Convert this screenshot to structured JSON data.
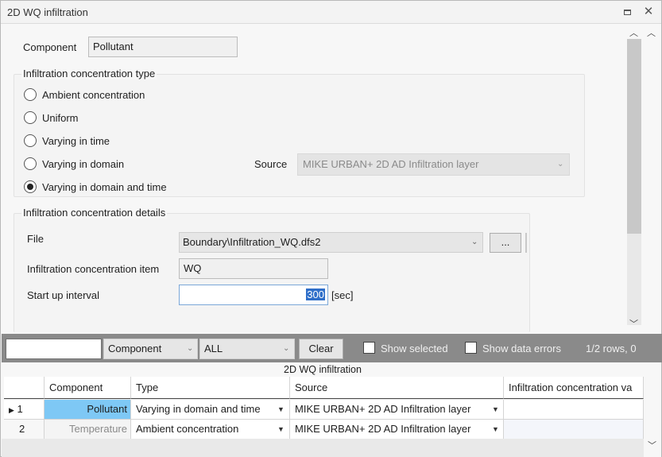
{
  "window": {
    "title": "2D WQ infiltration"
  },
  "form": {
    "component_label": "Component",
    "component_value": "Pollutant",
    "type_group_title": "Infiltration concentration type",
    "radio_options": [
      {
        "label": "Ambient concentration",
        "checked": false
      },
      {
        "label": "Uniform",
        "checked": false
      },
      {
        "label": "Varying in time",
        "checked": false
      },
      {
        "label": "Varying in domain",
        "checked": false
      },
      {
        "label": "Varying in domain and time",
        "checked": true
      }
    ],
    "source_label": "Source",
    "source_value": "MIKE URBAN+ 2D AD Infiltration layer",
    "details_group_title": "Infiltration concentration details",
    "file_label": "File",
    "file_value": "Boundary\\Infiltration_WQ.dfs2",
    "browse_button": "...",
    "item_label": "Infiltration concentration item",
    "item_value": "WQ",
    "startup_label": "Start up  interval",
    "startup_value": "300",
    "startup_unit": "[sec]"
  },
  "toolbar": {
    "search_value": "",
    "field_combo": "Component",
    "filter_combo": "ALL",
    "clear_button": "Clear",
    "show_selected": "Show selected",
    "show_errors": "Show data errors",
    "rows_info": "1/2 rows, 0"
  },
  "grid": {
    "caption": "2D WQ infiltration",
    "columns": [
      "Component",
      "Type",
      "Source",
      "Infiltration concentration va"
    ],
    "rows": [
      {
        "index": "1",
        "component": "Pollutant",
        "type": "Varying in domain and time",
        "source": "MIKE URBAN+ 2D AD Infiltration layer",
        "value": "",
        "current": true
      },
      {
        "index": "2",
        "component": "Temperature",
        "type": "Ambient concentration",
        "source": "MIKE URBAN+ 2D AD Infiltration layer",
        "value": "",
        "current": false
      }
    ]
  },
  "colors": {
    "selected_cell": "#7ec8f5",
    "toolbar_bg": "#8a8a8a",
    "highlight": "#2f6fc9"
  }
}
